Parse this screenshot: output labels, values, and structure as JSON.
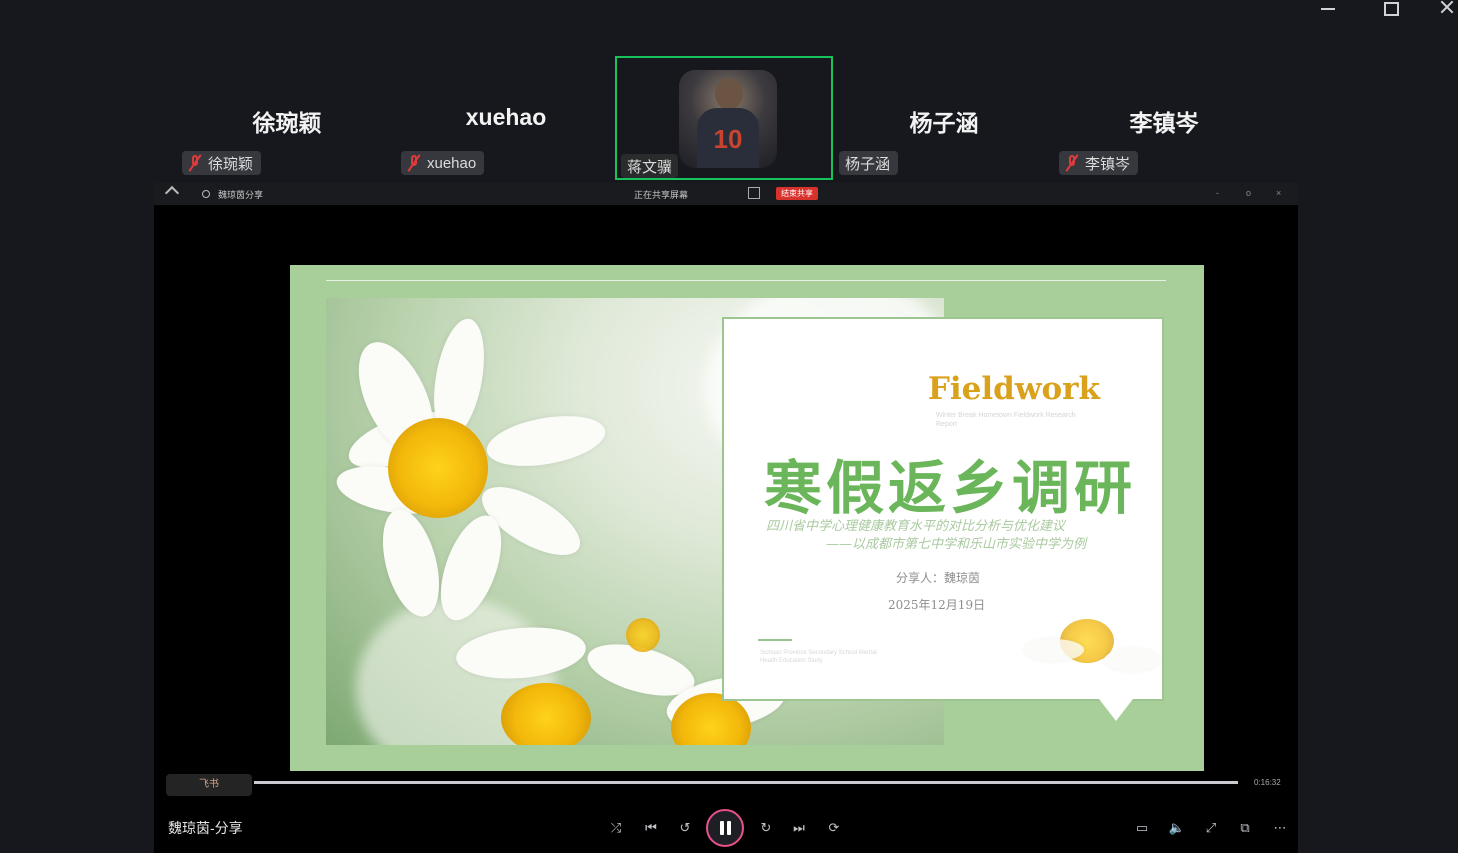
{
  "participants": [
    {
      "name": "徐琬颖",
      "tag": "徐琬颖",
      "muted": true
    },
    {
      "name": "xuehao",
      "tag": "xuehao",
      "muted": true
    },
    {
      "tag": "蒋文骥",
      "active": true,
      "avatar_number": "10"
    },
    {
      "name": "杨子涵",
      "tag": "杨子涵",
      "muted": false
    },
    {
      "name": "李镇岑",
      "tag": "李镇岑",
      "muted": true
    }
  ],
  "share_bar": {
    "title": "魏琼茵分享",
    "status": "正在共享屏幕",
    "end_label": "结束共享",
    "controls": [
      "-",
      "o",
      "×"
    ]
  },
  "slide": {
    "en_title": "Fieldwork",
    "en_subtitle": "Winter Break Hometown Fieldwork Research Report",
    "cn_title": "寒假返乡调研",
    "subtitle_line1": "四川省中学心理健康教育水平的对比分析与优化建议",
    "subtitle_line2": "——以成都市第七中学和乐山市实验中学为例",
    "presenter": "分享人：魏琼茵",
    "date": "2025年12月19日",
    "fine_print": "Sichuan Province Secondary School Mental Health Education Study"
  },
  "player": {
    "watermark": "飞书",
    "time": "0:16:32",
    "progress": 1.0,
    "bottom_title": "魏琼茵-分享"
  },
  "colors": {
    "active_border": "#18c25a",
    "slide_green": "#a8cf9a",
    "title_green": "#6bb55a",
    "title_gold": "#d9a11c",
    "pause_ring": "#e9508d",
    "muted_red": "#e03b3b"
  }
}
